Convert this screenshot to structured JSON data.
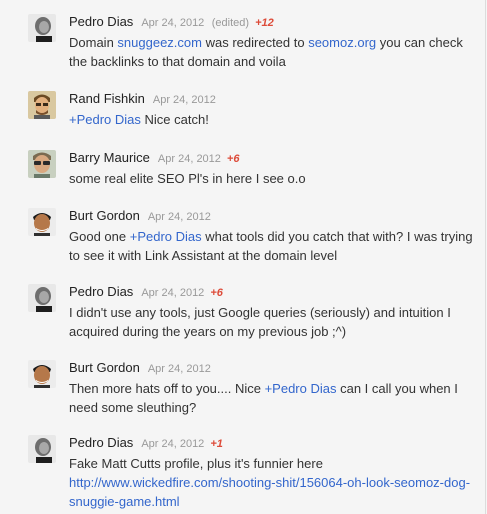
{
  "comments": [
    {
      "author": "Pedro Dias",
      "date": "Apr 24, 2012",
      "edited": "(edited)",
      "plus": "+12",
      "text": {
        "pre": "Domain ",
        "link1": "snuggeez.com",
        "mid": " was redirected to ",
        "link2": "seomoz.org",
        "post": " you can check the backlinks to that domain and voila"
      }
    },
    {
      "author": "Rand Fishkin",
      "date": "Apr 24, 2012",
      "text": {
        "mention": "Pedro Dias",
        "post": " Nice catch!"
      }
    },
    {
      "author": "Barry Maurice",
      "date": "Apr 24, 2012",
      "plus": "+6",
      "text": {
        "body": "some real elite SEO Pl's in here I see o.o"
      }
    },
    {
      "author": "Burt Gordon",
      "date": "Apr 24, 2012",
      "text": {
        "pre": "Good one ",
        "mention": "Pedro Dias",
        "post": " what tools did you catch that with? I was trying to see it with Link Assistant at the domain level"
      }
    },
    {
      "author": "Pedro Dias",
      "date": "Apr 24, 2012",
      "plus": "+6",
      "text": {
        "body": "I didn't use any tools, just Google queries (seriously) and intuition I acquired during the years on my previous job ;^)"
      }
    },
    {
      "author": "Burt Gordon",
      "date": "Apr 24, 2012",
      "text": {
        "pre": "Then more hats off to you.... Nice ",
        "mention": "Pedro Dias",
        "post": " can I call you when I need some sleuthing?"
      }
    },
    {
      "author": "Pedro Dias",
      "date": "Apr 24, 2012",
      "plus": "+1",
      "text": {
        "body": "Fake Matt Cutts profile, plus it's funnier here",
        "url": "http://www.wickedfire.com/shooting-shit/156064-oh-look-seomoz-dog-snuggie-game.html"
      }
    }
  ],
  "mention_prefix": "+",
  "colors": {
    "background": "#f5f5f5",
    "name": "#222222",
    "date": "#999999",
    "plus_one": "#dd4b39",
    "link": "#3366cc",
    "text": "#333333"
  },
  "avatars": [
    "pedro-avatar-icon",
    "rand-avatar-icon",
    "barry-avatar-icon",
    "burt-avatar-icon"
  ]
}
